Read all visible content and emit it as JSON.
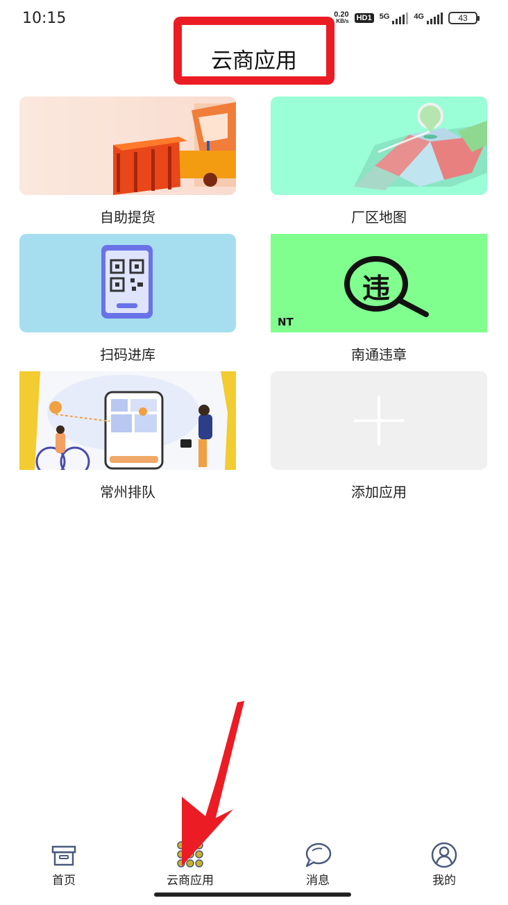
{
  "status_bar": {
    "time": "10:15",
    "net_speed_value": "0.20",
    "net_speed_unit": "KB/s",
    "hd_label": "HD1",
    "signal1_label": "5G",
    "signal2_label": "4G",
    "battery": "43"
  },
  "header": {
    "title": "云商应用"
  },
  "apps": [
    {
      "label": "自助提货",
      "icon": "truck-illustration"
    },
    {
      "label": "厂区地图",
      "icon": "map-illustration"
    },
    {
      "label": "扫码进库",
      "icon": "qr-phone-illustration"
    },
    {
      "label": "南通违章",
      "icon": "violation-search-illustration",
      "badge": "NT",
      "glyph": "违"
    },
    {
      "label": "常州排队",
      "icon": "queue-map-illustration"
    },
    {
      "label": "添加应用",
      "icon": "plus-icon"
    }
  ],
  "bottom_nav": {
    "items": [
      {
        "label": "首页",
        "icon": "home-box-icon"
      },
      {
        "label": "云商应用",
        "icon": "apps-grid-icon",
        "active": true
      },
      {
        "label": "消息",
        "icon": "chat-bubble-icon"
      },
      {
        "label": "我的",
        "icon": "user-icon"
      }
    ]
  },
  "colors": {
    "highlight_red": "#ec1c24",
    "apps_icon_gold": "#c9b22a",
    "nav_icon_blue": "#4a5a7c"
  }
}
